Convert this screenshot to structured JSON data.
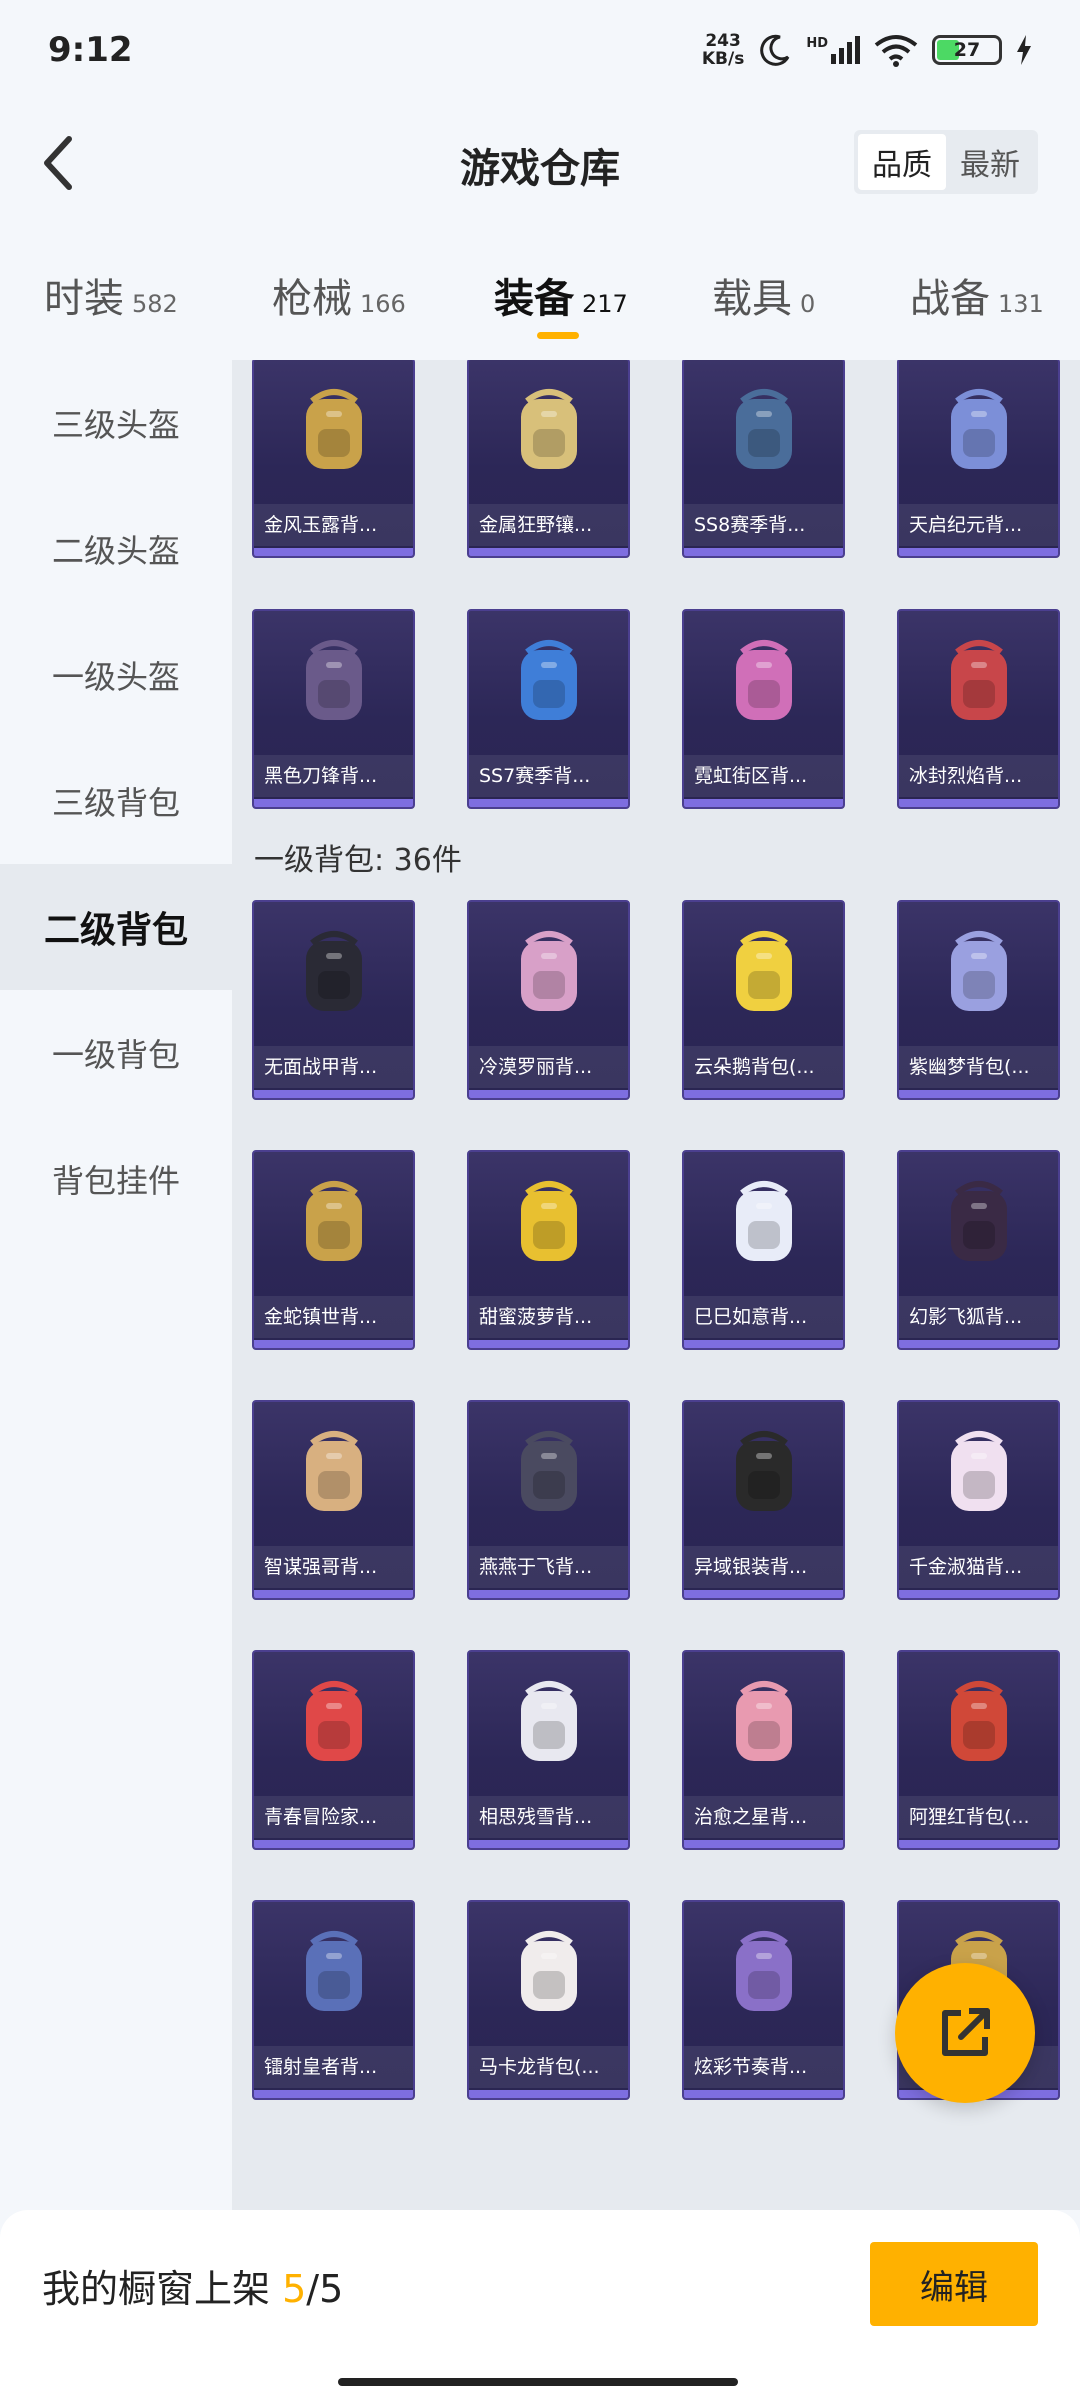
{
  "status": {
    "time": "9:12",
    "net_speed": "243",
    "net_unit": "KB/s",
    "battery": "27",
    "hd": "HD"
  },
  "header": {
    "title": "游戏仓库",
    "sort_options": [
      "品质",
      "最新"
    ]
  },
  "tabs": [
    {
      "label": "时装",
      "count": "582"
    },
    {
      "label": "枪械",
      "count": "166"
    },
    {
      "label": "装备",
      "count": "217"
    },
    {
      "label": "载具",
      "count": "0"
    },
    {
      "label": "战备",
      "count": "131"
    }
  ],
  "sidebar": [
    "三级头盔",
    "二级头盔",
    "一级头盔",
    "三级背包",
    "二级背包",
    "一级背包",
    "背包挂件"
  ],
  "section_label": "一级背包: 36件",
  "rows": [
    [
      "金风玉露背...",
      "金属狂野镶...",
      "SS8赛季背...",
      "天启纪元背..."
    ],
    [
      "黑色刀锋背...",
      "SS7赛季背...",
      "霓虹街区背...",
      "冰封烈焰背..."
    ],
    [
      "无面战甲背...",
      "冷漠罗丽背...",
      "云朵鹅背包(...",
      "紫幽梦背包(..."
    ],
    [
      "金蛇镇世背...",
      "甜蜜菠萝背...",
      "巳巳如意背...",
      "幻影飞狐背..."
    ],
    [
      "智谋强哥背...",
      "燕燕于飞背...",
      "异域银装背...",
      "千金淑猫背..."
    ],
    [
      "青春冒险家...",
      "相思残雪背...",
      "治愈之星背...",
      "阿狸红背包(..."
    ],
    [
      "镭射皇者背...",
      "马卡龙背包(...",
      "炫彩节奏背...",
      ""
    ]
  ],
  "bottom": {
    "shelf_label": "我的橱窗上架",
    "shelf_current": "5",
    "shelf_sep": "/",
    "shelf_total": "5",
    "edit_label": "编辑"
  },
  "colors": {
    "accent": "#ffb100",
    "card_bg": "#2c2757",
    "card_border": "#4b3f8f"
  }
}
